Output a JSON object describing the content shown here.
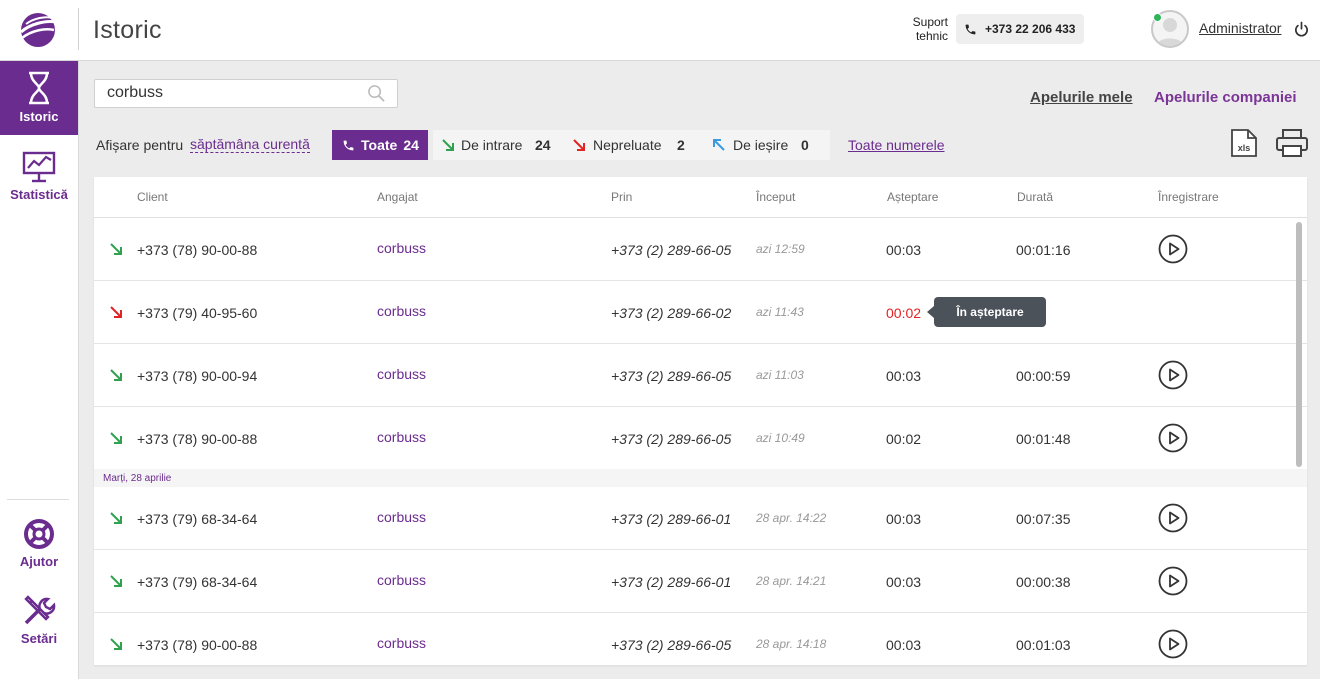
{
  "header": {
    "title": "Istoric",
    "support_label": "Suport tehnic",
    "support_phone": "+373 22 206 433",
    "user": "Administrator"
  },
  "sidebar": {
    "items": [
      {
        "label": "Istoric",
        "icon": "hourglass-icon",
        "active": true
      },
      {
        "label": "Statistică",
        "icon": "chart-icon",
        "active": false
      },
      {
        "label": "Ajutor",
        "icon": "lifebuoy-icon",
        "active": false
      },
      {
        "label": "Setări",
        "icon": "tools-icon",
        "active": false
      }
    ]
  },
  "search": {
    "value": "corbuss"
  },
  "links": {
    "my_calls": "Apelurile mele",
    "company_calls": "Apelurile companiei"
  },
  "filters": {
    "show_for": "Afișare pentru",
    "period": "săptămâna curentă",
    "all": {
      "label": "Toate",
      "count": "24"
    },
    "incoming": {
      "label": "De intrare",
      "count": "24"
    },
    "missed": {
      "label": "Nepreluate",
      "count": "2"
    },
    "outgoing": {
      "label": "De ieșire",
      "count": "0"
    },
    "all_numbers": "Toate numerele"
  },
  "table": {
    "headers": {
      "client": "Client",
      "employee": "Angajat",
      "via": "Prin",
      "start": "Început",
      "wait": "Așteptare",
      "duration": "Durată",
      "recording": "Înregistrare"
    },
    "tooltip": "În așteptare",
    "date_separator": "Marți, 28 aprilie",
    "rows": [
      {
        "type": "incoming",
        "client": "+373 (78) 90-00-88",
        "employee": "corbuss",
        "via": "+373 (2) 289-66-05",
        "start": "azi 12:59",
        "wait": "00:03",
        "duration": "00:01:16"
      },
      {
        "type": "missed",
        "client": "+373 (79) 40-95-60",
        "employee": "corbuss",
        "via": "+373 (2) 289-66-02",
        "start": "azi 11:43",
        "wait": "00:02",
        "duration": ""
      },
      {
        "type": "incoming",
        "client": "+373 (78) 90-00-94",
        "employee": "corbuss",
        "via": "+373 (2) 289-66-05",
        "start": "azi 11:03",
        "wait": "00:03",
        "duration": "00:00:59"
      },
      {
        "type": "incoming",
        "client": "+373 (78) 90-00-88",
        "employee": "corbuss",
        "via": "+373 (2) 289-66-05",
        "start": "azi 10:49",
        "wait": "00:02",
        "duration": "00:01:48"
      },
      {
        "type": "incoming",
        "client": "+373 (79) 68-34-64",
        "employee": "corbuss",
        "via": "+373 (2) 289-66-01",
        "start": "28 apr. 14:22",
        "wait": "00:03",
        "duration": "00:07:35"
      },
      {
        "type": "incoming",
        "client": "+373 (79) 68-34-64",
        "employee": "corbuss",
        "via": "+373 (2) 289-66-01",
        "start": "28 apr. 14:21",
        "wait": "00:03",
        "duration": "00:00:38"
      },
      {
        "type": "incoming",
        "client": "+373 (78) 90-00-88",
        "employee": "corbuss",
        "via": "+373 (2) 289-66-05",
        "start": "28 apr. 14:18",
        "wait": "00:03",
        "duration": "00:01:03"
      }
    ]
  },
  "colors": {
    "brand": "#6b2c8f",
    "incoming": "#2fa14f",
    "missed": "#e02424",
    "outgoing": "#3b9be0"
  }
}
